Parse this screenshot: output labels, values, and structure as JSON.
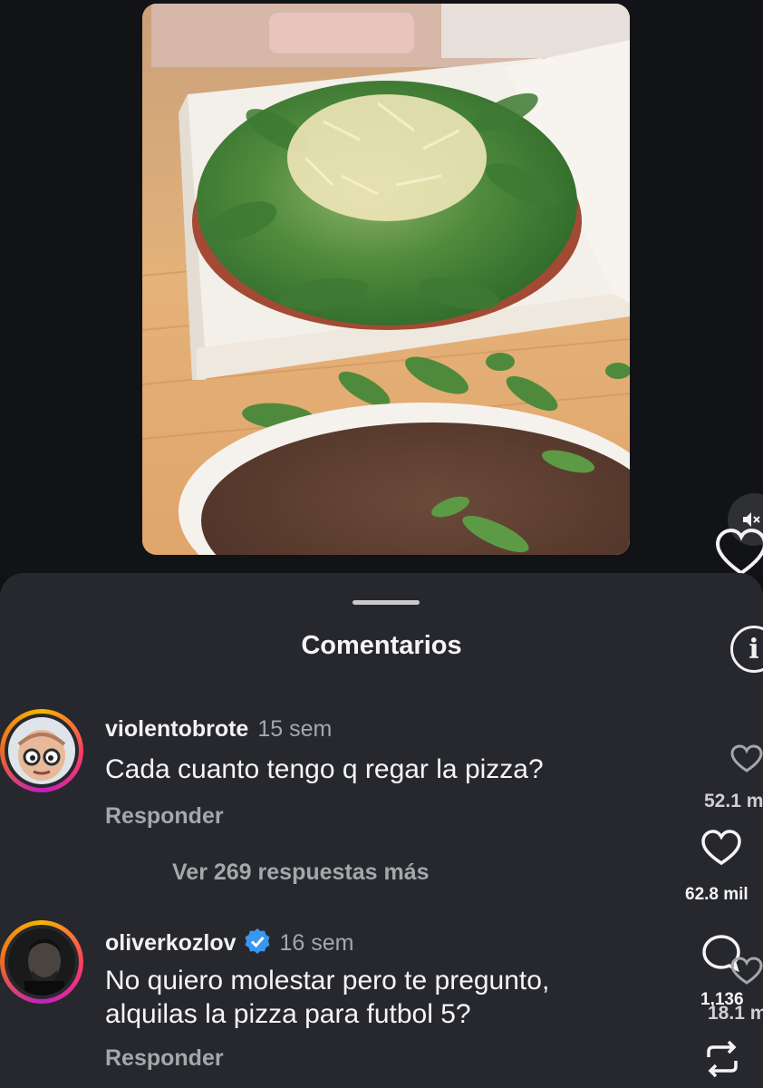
{
  "sheet": {
    "title": "Comentarios"
  },
  "comments": [
    {
      "username": "violentobrote",
      "time": "15 sem",
      "text": "Cada cuanto tengo q regar la pizza?",
      "reply_label": "Responder",
      "like_count": "52.1 m",
      "more_replies": "Ver 269 respuestas más"
    },
    {
      "username": "oliverkozlov",
      "time": "16 sem",
      "text_line1": "No quiero molestar pero te pregunto,",
      "text_line2": "alquilas la pizza para futbol 5?",
      "reply_label": "Responder",
      "like_count": "18.1 m"
    }
  ],
  "reel_actions": {
    "likes": "62.8 mil",
    "comments": "1,136"
  },
  "icons": {
    "mute": "speaker-muted-icon",
    "like": "heart-icon",
    "comment": "comment-bubble-icon",
    "repost": "repost-icon",
    "info": "info-icon",
    "verified": "verified-badge-icon"
  },
  "colors": {
    "sheet_bg": "#27282d",
    "verified_blue": "#3897f0",
    "muted_text": "#a6a7ab"
  }
}
